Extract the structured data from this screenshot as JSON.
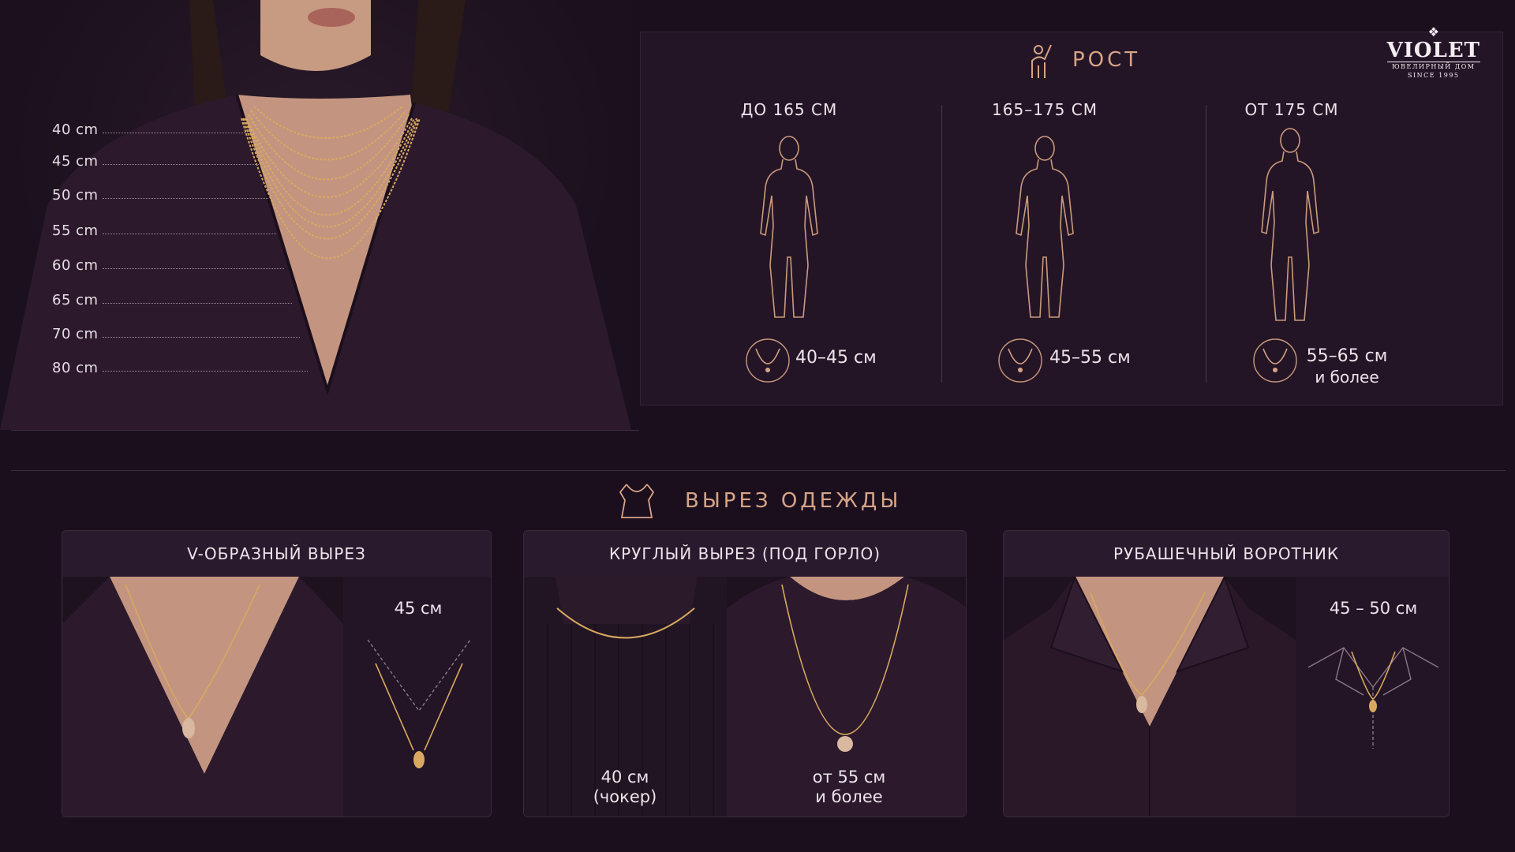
{
  "brand": {
    "name": "VIOLET",
    "tagline": "ЮВЕЛИРНЫЙ ДОМ",
    "since": "SINCE 1995"
  },
  "hero": {
    "lengths": [
      "40 cm",
      "45 cm",
      "50 cm",
      "55 cm",
      "60 cm",
      "65 cm",
      "70 cm",
      "80 cm"
    ]
  },
  "height": {
    "title": "РОСТ",
    "columns": [
      {
        "header": "ДО 165 СМ",
        "value": "40–45 см",
        "value_extra": ""
      },
      {
        "header": "165–175 СМ",
        "value": "45–55 см",
        "value_extra": ""
      },
      {
        "header": "ОТ 175 СМ",
        "value": "55–65 см",
        "value_extra": "и более"
      }
    ]
  },
  "neckline": {
    "title": "ВЫРЕЗ ОДЕЖДЫ",
    "cards": [
      {
        "title": "V-ОБРАЗНЫЙ ВЫРЕЗ",
        "length": "45 см"
      },
      {
        "title": "КРУГЛЫЙ ВЫРЕЗ (ПОД ГОРЛО)",
        "left_caption_1": "40 см",
        "left_caption_2": "(чокер)",
        "right_caption_1": "от 55 см",
        "right_caption_2": "и более"
      },
      {
        "title": "РУБАШЕЧНЫЙ ВОРОТНИК",
        "length": "45 – 50 см"
      }
    ]
  },
  "colors": {
    "background": "#1b0f1d",
    "panel": "#241526",
    "accent_gold": "#d7a486",
    "text": "#ece4ea"
  }
}
